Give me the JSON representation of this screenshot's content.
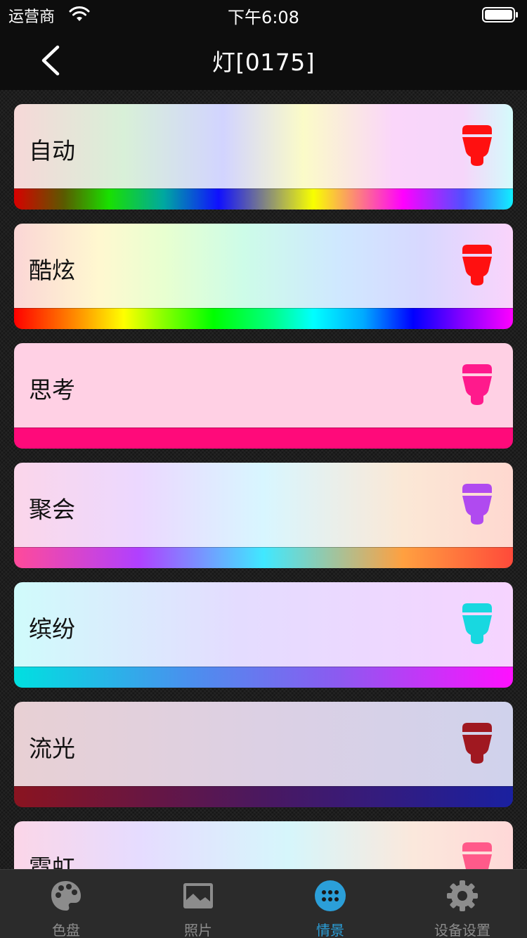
{
  "status": {
    "carrier": "运营商",
    "time": "下午6:08"
  },
  "nav": {
    "title": "灯[0175]"
  },
  "scenes": [
    {
      "name": "自动",
      "bulb_color": "#ff1010"
    },
    {
      "name": "酷炫",
      "bulb_color": "#ff1010"
    },
    {
      "name": "思考",
      "bulb_color": "#ff1a8c"
    },
    {
      "name": "聚会",
      "bulb_color": "#b04af0"
    },
    {
      "name": "缤纷",
      "bulb_color": "#18d8e0"
    },
    {
      "name": "流光",
      "bulb_color": "#a01820"
    },
    {
      "name": "霓虹",
      "bulb_color": "#ff5a8a"
    }
  ],
  "tabs": [
    {
      "label": "色盘",
      "icon": "palette-icon",
      "active": false
    },
    {
      "label": "照片",
      "icon": "photo-icon",
      "active": false
    },
    {
      "label": "情景",
      "icon": "scene-icon",
      "active": true
    },
    {
      "label": "设备设置",
      "icon": "gear-icon",
      "active": false
    }
  ],
  "colors": {
    "accent": "#2b9fd9",
    "inactive": "#8c8c8c",
    "background": "#1b1b1b"
  }
}
